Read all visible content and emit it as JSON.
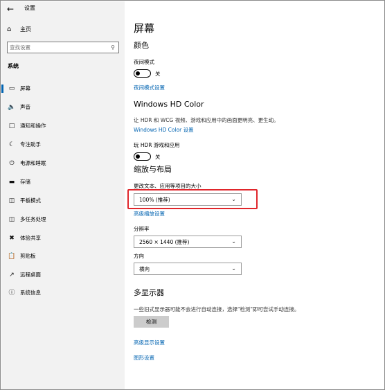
{
  "window": {
    "title": "设置",
    "back_icon": "back-arrow-icon"
  },
  "sidebar": {
    "home": {
      "label": "主页",
      "icon": "home-icon"
    },
    "search": {
      "placeholder": "查找设置",
      "icon": "search-icon"
    },
    "section_title": "系统",
    "items": [
      {
        "label": "屏幕",
        "icon": "monitor-icon",
        "active": true
      },
      {
        "label": "声音",
        "icon": "speaker-icon"
      },
      {
        "label": "通知和操作",
        "icon": "notification-icon"
      },
      {
        "label": "专注助手",
        "icon": "moon-icon"
      },
      {
        "label": "电源和睡眠",
        "icon": "power-icon"
      },
      {
        "label": "存储",
        "icon": "storage-icon"
      },
      {
        "label": "平板模式",
        "icon": "tablet-icon"
      },
      {
        "label": "多任务处理",
        "icon": "multitask-icon"
      },
      {
        "label": "体验共享",
        "icon": "share-icon"
      },
      {
        "label": "剪贴板",
        "icon": "clipboard-icon"
      },
      {
        "label": "远程桌面",
        "icon": "remote-desktop-icon"
      },
      {
        "label": "系统信息",
        "icon": "info-icon"
      }
    ]
  },
  "main": {
    "page_title": "屏幕",
    "color": {
      "heading": "颜色",
      "night_light_label": "夜间模式",
      "night_light_state": "关",
      "night_light_link": "夜间模式设置"
    },
    "hdr": {
      "heading": "Windows HD Color",
      "description": "让 HDR 和 WCG 视频、游戏和应用中的画面更明亮、更生动。",
      "link": "Windows HD Color 设置",
      "play_hdr_label": "玩 HDR 游戏和应用",
      "play_hdr_state": "关"
    },
    "scale_layout": {
      "heading": "缩放与布局",
      "scale_label": "更改文本、应用等项目的大小",
      "scale_value": "100% (推荐)",
      "advanced_scaling_link": "高级缩放设置",
      "resolution_label": "分辨率",
      "resolution_value": "2560 × 1440 (推荐)",
      "orientation_label": "方向",
      "orientation_value": "横向"
    },
    "multi_display": {
      "heading": "多显示器",
      "description": "一些旧式显示器可能不会进行自动连接，选择\"检测\"即可尝试手动连接。",
      "detect_button": "检测",
      "advanced_display_link": "高级显示设置",
      "graphics_link": "图形设置"
    }
  },
  "colors": {
    "accent": "#0063b1",
    "highlight": "#e0262b",
    "sidebar_bg": "#f2f2f2"
  }
}
